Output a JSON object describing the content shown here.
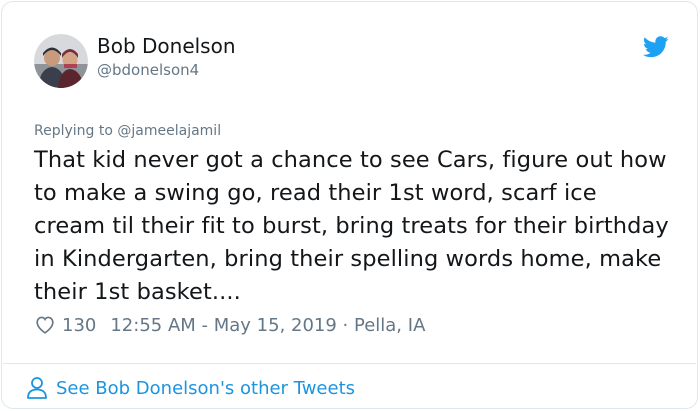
{
  "author": {
    "name": "Bob Donelson",
    "handle": "@bdonelson4"
  },
  "reply": {
    "prefix": "Replying to",
    "mention": "@jameelajamil"
  },
  "tweet": {
    "text": "That kid never got a chance to see Cars, figure out how to make a swing go, read their 1st word, scarf ice cream til their fit to burst, bring treats for their birthday in Kindergarten, bring their spelling words home, make their 1st basket...."
  },
  "meta": {
    "likes": "130",
    "timestamp": "12:55 AM - May 15, 2019 · Pella, IA"
  },
  "footer": {
    "see_more": "See Bob Donelson's other Tweets"
  },
  "icons": {
    "brand": "twitter-bird-icon",
    "like": "heart-icon",
    "profile": "person-icon"
  },
  "colors": {
    "brand_blue": "#1da1f2",
    "link_blue": "#1b95e0",
    "secondary_text": "#657786",
    "primary_text": "#14171a"
  }
}
